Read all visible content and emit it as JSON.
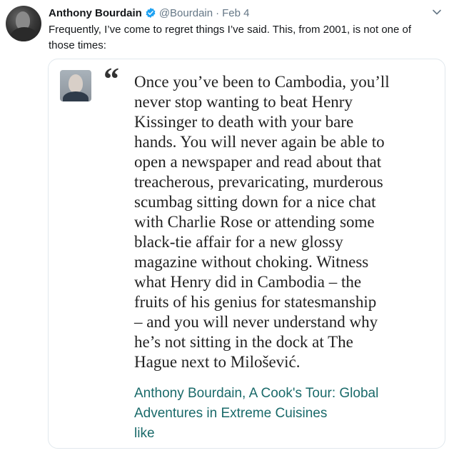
{
  "tweet": {
    "author_name": "Anthony Bourdain",
    "handle": "@Bourdain",
    "separator": "·",
    "date": "Feb 4",
    "text": "Frequently, I’ve come to regret things I’ve said. This, from 2001, is not one of those times:",
    "verified_icon": "verified-badge-icon",
    "menu_icon": "chevron-down-icon"
  },
  "card": {
    "quote_mark": "“",
    "quote": "Once you’ve been to Cambodia, you’ll\nnever stop wanting to beat Henry\nKissinger to death with your bare\nhands. You will never again be able to\nopen a newspaper and read about that\ntreacherous, prevaricating, murderous\nscumbag sitting down for a nice chat\nwith Charlie Rose or attending some\nblack-tie affair for a new glossy\nmagazine without choking. Witness\nwhat Henry did in Cambodia – the\nfruits of his genius for statesmanship\n– and you will never understand why\nhe’s not sitting in the dock at The\nHague next to Milošević.",
    "attribution": "Anthony Bourdain, A Cook's Tour: Global\nAdventures in Extreme Cuisines\nlike"
  },
  "colors": {
    "verified_blue": "#1da1f2",
    "muted_gray": "#657786",
    "attribution_teal": "#1a6a6a",
    "card_border": "#e1e8ed"
  }
}
